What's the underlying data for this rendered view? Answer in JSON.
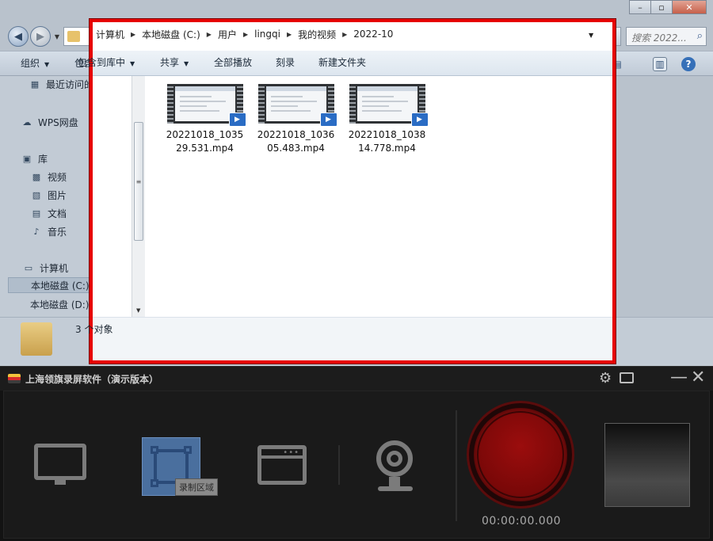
{
  "explorer": {
    "breadcrumbs": [
      "计算机",
      "本地磁盘 (C:)",
      "用户",
      "lingqi",
      "我的视频",
      "2022-10"
    ],
    "search_placeholder": "搜索 2022...",
    "toolbar": {
      "organize": "组织",
      "add_to_library": "包含到库中",
      "share": "共享",
      "play_all": "全部播放",
      "burn": "刻录",
      "new_folder": "新建文件夹"
    },
    "sidebar": {
      "recent": "最近访问的位置",
      "wps": "WPS网盘",
      "library": "库",
      "video": "视频",
      "pictures": "图片",
      "documents": "文档",
      "music": "音乐",
      "computer": "计算机",
      "drive_c": "本地磁盘 (C:)",
      "drive_d": "本地磁盘 (D:)"
    },
    "files": [
      {
        "name_line1": "20221018_1035",
        "name_line2": "29.531.mp4"
      },
      {
        "name_line1": "20221018_1036",
        "name_line2": "05.483.mp4"
      },
      {
        "name_line1": "20221018_1038",
        "name_line2": "14.778.mp4"
      }
    ],
    "status": "3 个对象"
  },
  "recorder": {
    "title": "上海领旗录屏软件（演示版本）",
    "region_tooltip": "录制区域",
    "timer": "00:00:00.000",
    "accent_color": "#b11616"
  }
}
